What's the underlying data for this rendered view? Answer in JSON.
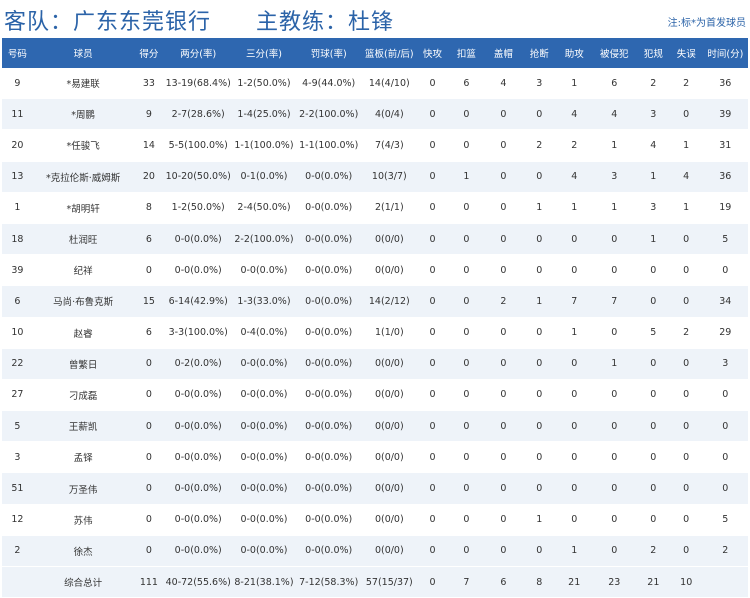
{
  "header": {
    "team_text": "客队：广东东莞银行",
    "coach_text": "主教练：杜锋",
    "note": "注:标*为首发球员"
  },
  "columns": [
    "号码",
    "球员",
    "得分",
    "两分(率)",
    "三分(率)",
    "罚球(率)",
    "篮板(前/后)",
    "快攻",
    "扣篮",
    "盖帽",
    "抢断",
    "助攻",
    "被侵犯",
    "犯规",
    "失误",
    "时间(分)"
  ],
  "players": [
    [
      "9",
      "*易建联",
      "33",
      "13-19(68.4%)",
      "1-2(50.0%)",
      "4-9(44.0%)",
      "14(4/10)",
      "0",
      "6",
      "4",
      "3",
      "1",
      "6",
      "2",
      "2",
      "36"
    ],
    [
      "11",
      "*周鹏",
      "9",
      "2-7(28.6%)",
      "1-4(25.0%)",
      "2-2(100.0%)",
      "4(0/4)",
      "0",
      "0",
      "0",
      "0",
      "4",
      "4",
      "3",
      "0",
      "39"
    ],
    [
      "20",
      "*任骏飞",
      "14",
      "5-5(100.0%)",
      "1-1(100.0%)",
      "1-1(100.0%)",
      "7(4/3)",
      "0",
      "0",
      "0",
      "2",
      "2",
      "1",
      "4",
      "1",
      "31"
    ],
    [
      "13",
      "*克拉伦斯·威姆斯",
      "20",
      "10-20(50.0%)",
      "0-1(0.0%)",
      "0-0(0.0%)",
      "10(3/7)",
      "0",
      "1",
      "0",
      "0",
      "4",
      "3",
      "1",
      "4",
      "36"
    ],
    [
      "1",
      "*胡明轩",
      "8",
      "1-2(50.0%)",
      "2-4(50.0%)",
      "0-0(0.0%)",
      "2(1/1)",
      "0",
      "0",
      "0",
      "1",
      "1",
      "1",
      "3",
      "1",
      "19"
    ],
    [
      "18",
      "杜润旺",
      "6",
      "0-0(0.0%)",
      "2-2(100.0%)",
      "0-0(0.0%)",
      "0(0/0)",
      "0",
      "0",
      "0",
      "0",
      "0",
      "0",
      "1",
      "0",
      "5"
    ],
    [
      "39",
      "纪祥",
      "0",
      "0-0(0.0%)",
      "0-0(0.0%)",
      "0-0(0.0%)",
      "0(0/0)",
      "0",
      "0",
      "0",
      "0",
      "0",
      "0",
      "0",
      "0",
      "0"
    ],
    [
      "6",
      "马尚·布鲁克斯",
      "15",
      "6-14(42.9%)",
      "1-3(33.0%)",
      "0-0(0.0%)",
      "14(2/12)",
      "0",
      "0",
      "2",
      "1",
      "7",
      "7",
      "0",
      "0",
      "34"
    ],
    [
      "10",
      "赵睿",
      "6",
      "3-3(100.0%)",
      "0-4(0.0%)",
      "0-0(0.0%)",
      "1(1/0)",
      "0",
      "0",
      "0",
      "0",
      "1",
      "0",
      "5",
      "2",
      "29"
    ],
    [
      "22",
      "曾繁日",
      "0",
      "0-2(0.0%)",
      "0-0(0.0%)",
      "0-0(0.0%)",
      "0(0/0)",
      "0",
      "0",
      "0",
      "0",
      "0",
      "1",
      "0",
      "0",
      "3"
    ],
    [
      "27",
      "刁成磊",
      "0",
      "0-0(0.0%)",
      "0-0(0.0%)",
      "0-0(0.0%)",
      "0(0/0)",
      "0",
      "0",
      "0",
      "0",
      "0",
      "0",
      "0",
      "0",
      "0"
    ],
    [
      "5",
      "王薪凯",
      "0",
      "0-0(0.0%)",
      "0-0(0.0%)",
      "0-0(0.0%)",
      "0(0/0)",
      "0",
      "0",
      "0",
      "0",
      "0",
      "0",
      "0",
      "0",
      "0"
    ],
    [
      "3",
      "孟铎",
      "0",
      "0-0(0.0%)",
      "0-0(0.0%)",
      "0-0(0.0%)",
      "0(0/0)",
      "0",
      "0",
      "0",
      "0",
      "0",
      "0",
      "0",
      "0",
      "0"
    ],
    [
      "51",
      "万圣伟",
      "0",
      "0-0(0.0%)",
      "0-0(0.0%)",
      "0-0(0.0%)",
      "0(0/0)",
      "0",
      "0",
      "0",
      "0",
      "0",
      "0",
      "0",
      "0",
      "0"
    ],
    [
      "12",
      "苏伟",
      "0",
      "0-0(0.0%)",
      "0-0(0.0%)",
      "0-0(0.0%)",
      "0(0/0)",
      "0",
      "0",
      "0",
      "1",
      "0",
      "0",
      "0",
      "0",
      "5"
    ],
    [
      "2",
      "徐杰",
      "0",
      "0-0(0.0%)",
      "0-0(0.0%)",
      "0-0(0.0%)",
      "0(0/0)",
      "0",
      "0",
      "0",
      "0",
      "1",
      "0",
      "2",
      "0",
      "2"
    ]
  ],
  "totals": [
    "",
    "综合总计",
    "111",
    "40-72(55.6%)",
    "8-21(38.1%)",
    "7-12(58.3%)",
    "57(15/37)",
    "0",
    "7",
    "6",
    "8",
    "21",
    "23",
    "21",
    "10",
    ""
  ]
}
